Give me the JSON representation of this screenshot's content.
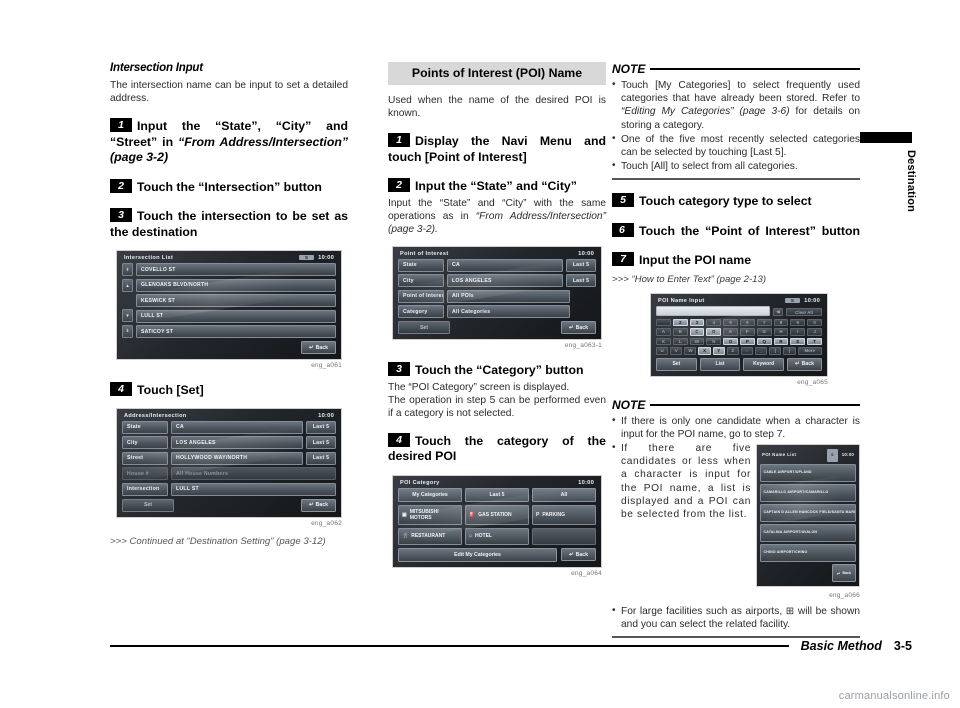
{
  "page": {
    "footer_title": "Basic Method",
    "footer_page": "3-5",
    "side_tab": "Destination",
    "watermark": "carmanualsonline.info"
  },
  "col1": {
    "section_title": "Intersection Input",
    "intro": "The intersection name can be input to set a detailed address.",
    "steps": [
      {
        "num": "1",
        "text": "Input the “State”, “City” and “Street”",
        "text2_plain": "in ",
        "text2_italic": "“From Address/Intersection” (page 3-2)"
      },
      {
        "num": "2",
        "text": "Touch the “Intersection” button"
      },
      {
        "num": "3",
        "text": "Touch the intersection to be set as the destination"
      },
      {
        "num": "4",
        "text": "Touch [Set]"
      }
    ],
    "shot1": {
      "title": "Intersection List",
      "gps": "S",
      "clock": "10:00",
      "items": [
        "COVELLO ST",
        "GLENOAKS BLVD/NORTH",
        "KESWICK ST",
        "LULL ST",
        "SATICOY ST"
      ],
      "back": "Back",
      "caption": "eng_a061"
    },
    "shot2": {
      "title": "Address/Intersection",
      "clock": "10:00",
      "rows": [
        {
          "label": "State",
          "value": "CA",
          "button": "Last 5",
          "dim": false
        },
        {
          "label": "City",
          "value": "LOS ANGELES",
          "button": "Last 5",
          "dim": false
        },
        {
          "label": "Street",
          "value": "HOLLYWOOD WAY/NORTH",
          "button": "Last 5",
          "dim": false
        },
        {
          "label": "House #",
          "value": "All House Numbers",
          "button": "",
          "dim": true
        },
        {
          "label": "Intersection",
          "value": "LULL ST",
          "button": "",
          "dim": false
        }
      ],
      "set": "Set",
      "back": "Back",
      "caption": "eng_a062"
    },
    "continued": ">>> Continued at “Destination Setting” (page 3-12)"
  },
  "col2": {
    "banner": "Points of Interest (POI) Name",
    "intro": "Used when the name of the desired POI is known.",
    "steps": [
      {
        "num": "1",
        "text": "Display the Navi Menu and touch [Point of Interest]"
      },
      {
        "num": "2",
        "text": "Input the “State” and “City”"
      },
      {
        "num": "3",
        "text": "Touch the “Category” button"
      },
      {
        "num": "4",
        "text": "Touch the category of the desired POI"
      }
    ],
    "step2_body_plain": "Input the “State” and “City” with the same operations as in ",
    "step2_body_italic": "“From Address/Intersection” (page 3-2).",
    "step3_body_1": "The “POI Category” screen is displayed.",
    "step3_body_2": "The operation in step 5 can be performed even if a category is not selected.",
    "shot3": {
      "title": "Point of Interest",
      "clock": "10:00",
      "rows": [
        {
          "label": "State",
          "value": "CA",
          "button": "Last 5"
        },
        {
          "label": "City",
          "value": "LOS ANGELES",
          "button": "Last 5"
        },
        {
          "label": "Point of Interest",
          "value": "All POIs",
          "button": ""
        },
        {
          "label": "Category",
          "value": "All Categories",
          "button": ""
        }
      ],
      "set": "Set",
      "back": "Back",
      "caption": "eng_a063-1"
    },
    "shot4": {
      "title": "POI Category",
      "clock": "10:00",
      "tabs": [
        "My Categories",
        "Last 5",
        "All"
      ],
      "categories": [
        {
          "icon": "car-icon",
          "label": "MITSUBISHI MOTORS"
        },
        {
          "icon": "fuel-icon",
          "label": "GAS STATION"
        },
        {
          "icon": "parking-icon",
          "label": "PARKING"
        },
        {
          "icon": "restaurant-icon",
          "label": "RESTAURANT"
        },
        {
          "icon": "hotel-icon",
          "label": "HOTEL"
        },
        {
          "icon": "",
          "label": ""
        }
      ],
      "edit": "Edit My Categories",
      "back": "Back",
      "caption": "eng_a064"
    }
  },
  "col3": {
    "note1": {
      "head": "NOTE",
      "items": [
        {
          "plain1": "Touch [My Categories] to select frequently used categories that have already been stored. Refer to ",
          "italic": "“Editing My Categories” (page 3-6)",
          "plain2": " for details on storing a category."
        },
        {
          "plain1": "One of the five most recently selected categories can be selected by touching [Last 5].",
          "italic": "",
          "plain2": ""
        },
        {
          "plain1": "Touch [All] to select from all categories.",
          "italic": "",
          "plain2": ""
        }
      ]
    },
    "steps": [
      {
        "num": "5",
        "text": "Touch category type to select"
      },
      {
        "num": "6",
        "text": "Touch the “Point of Interest” button"
      },
      {
        "num": "7",
        "text": "Input the POI name"
      }
    ],
    "ref": ">>> “How to Enter Text” (page 2-13)",
    "shot5": {
      "title": "POI Name Input",
      "gps": "S",
      "clock": "10:00",
      "clear_all": "Clear All",
      "more": "More",
      "keys_row1": [
        "",
        "2",
        "3",
        "4",
        "5",
        "6",
        "7",
        "8",
        "9",
        "0"
      ],
      "keys_row2": [
        "A",
        "B",
        "C",
        "D",
        "E",
        "F",
        "G",
        "H",
        "I",
        "J"
      ],
      "keys_row3": [
        "K",
        "L",
        "M",
        "N",
        "O",
        "P",
        "Q",
        "R",
        "S",
        "T"
      ],
      "keys_row4": [
        "U",
        "V",
        "W",
        "X",
        "Y",
        "Z",
        "-",
        "_",
        "(",
        ")"
      ],
      "hot_keys": [
        "2",
        "3",
        "C",
        "D",
        "O",
        "P",
        "Q",
        "R",
        "S",
        "T",
        "X",
        "Y"
      ],
      "buttons": [
        "Set",
        "List",
        "Keyword"
      ],
      "back": "Back",
      "caption": "eng_a065"
    },
    "note2": {
      "head": "NOTE",
      "items": [
        {
          "plain1": "If there is only one candidate when a character is input for the POI name, go to step 7.",
          "italic": "",
          "plain2": ""
        },
        {
          "plain1": "If there are five candidates or less when a character is input for the POI name, a list is displayed and a POI can be selected from the list.",
          "italic": "",
          "plain2": ""
        },
        {
          "plain1": "For large facilities such as airports, ⊞ will be shown and you can select the related facility.",
          "italic": "",
          "plain2": ""
        }
      ]
    },
    "shot6": {
      "title": "POI Name List",
      "gps": "S",
      "clock": "10:00",
      "items": [
        {
          "label": "CABLE AIRPORT/UPLAND",
          "plus": false
        },
        {
          "label": "CAMARILLO AIRPORT/CAMARILLO",
          "plus": false
        },
        {
          "label": "CAPTAIN D ALLEN HANCOCK FIELD/SANTA MARIA",
          "plus": true
        },
        {
          "label": "CATALINA AIRPORT/AVALON",
          "plus": false
        },
        {
          "label": "CHINO AIRPORT/CHINO",
          "plus": false
        }
      ],
      "back": "Back",
      "caption": "eng_a066"
    }
  }
}
